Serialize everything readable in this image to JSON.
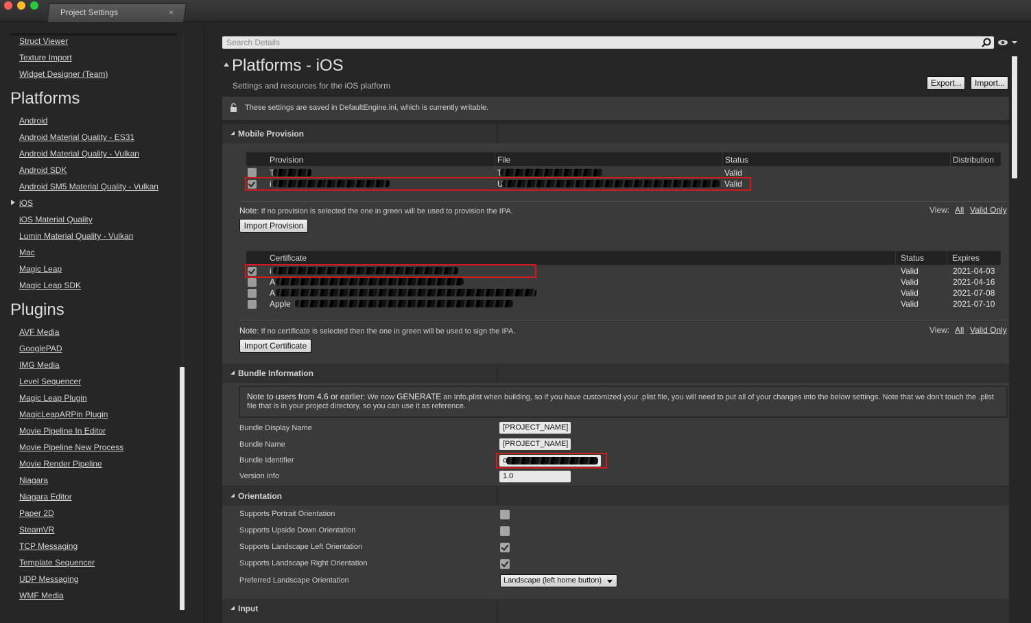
{
  "window": {
    "tab_title": "Project Settings",
    "tab_close": "×"
  },
  "sidebar": {
    "top_items": [
      "Struct Viewer",
      "Texture Import",
      "Widget Designer (Team)"
    ],
    "platforms_heading": "Platforms",
    "platform_items": [
      "Android",
      "Android Material Quality - ES31",
      "Android Material Quality - Vulkan",
      "Android SDK",
      "Android SM5 Material Quality - Vulkan",
      "iOS",
      "iOS Material Quality",
      "Lumin Material Quality - Vulkan",
      "Mac",
      "Magic Leap",
      "Magic Leap SDK"
    ],
    "plugins_heading": "Plugins",
    "plugin_items": [
      "AVF Media",
      "GooglePAD",
      "IMG Media",
      "Level Sequencer",
      "Magic Leap Plugin",
      "MagicLeapARPin Plugin",
      "Movie Pipeline In Editor",
      "Movie Pipeline New Process",
      "Movie Render Pipeline",
      "Niagara",
      "Niagara Editor",
      "Paper 2D",
      "SteamVR",
      "TCP Messaging",
      "Template Sequencer",
      "UDP Messaging",
      "WMF Media"
    ]
  },
  "search": {
    "placeholder": "Search Details"
  },
  "header": {
    "title": "Platforms - iOS",
    "subtitle": "Settings and resources for the iOS platform",
    "export_label": "Export...",
    "import_label": "Import...",
    "info_text": "These settings are saved in DefaultEngine.ini, which is currently writable."
  },
  "mobile_provision": {
    "section_label": "Mobile Provision",
    "provision_table": {
      "columns": [
        "Provision",
        "File",
        "Status",
        "Distribution"
      ],
      "rows": [
        {
          "provision": "T",
          "file": "T",
          "status": "Valid",
          "checked": false
        },
        {
          "provision": "i",
          "file": "U",
          "status": "Valid",
          "checked": true
        }
      ]
    },
    "provision_note_label": "Note",
    "provision_note": ": If no provision is selected the one in green will be used to provision the IPA.",
    "view_label": "View:",
    "view_all": "All",
    "view_valid_only": "Valid Only",
    "import_provision_label": "Import Provision",
    "certificate_table": {
      "columns": [
        "Certificate",
        "Status",
        "Expires"
      ],
      "rows": [
        {
          "certificate": "i",
          "status": "Valid",
          "expires": "2021-04-03",
          "checked": true
        },
        {
          "certificate": "A",
          "status": "Valid",
          "expires": "2021-04-16",
          "checked": false
        },
        {
          "certificate": "A",
          "status": "Valid",
          "expires": "2021-07-08",
          "checked": false
        },
        {
          "certificate": "Apple",
          "status": "Valid",
          "expires": "2021-07-10",
          "checked": false
        }
      ]
    },
    "certificate_note_label": "Note",
    "certificate_note": ": If no certificate is selected then the one in green will be used to sign the IPA.",
    "import_certificate_label": "Import Certificate"
  },
  "bundle_information": {
    "section_label": "Bundle Information",
    "note_label": "Note to users from 4.6 or earlier",
    "note_mid": ": We now ",
    "note_generate": "GENERATE",
    "note_text": " an Info.plist when building, so if you have customized your .plist file, you will need to put all of your changes into the below settings. Note that we don't touch the .plist file that is in your project directory, so you can use it as reference.",
    "display_name_label": "Bundle Display Name",
    "display_name_value": "[PROJECT_NAME]",
    "bundle_name_label": "Bundle Name",
    "bundle_name_value": "[PROJECT_NAME]",
    "identifier_label": "Bundle Identifier",
    "identifier_value": "c",
    "version_label": "Version Info",
    "version_value": "1.0"
  },
  "orientation": {
    "section_label": "Orientation",
    "portrait_label": "Supports Portrait Orientation",
    "portrait_checked": false,
    "upside_down_label": "Supports Upside Down Orientation",
    "upside_down_checked": false,
    "landscape_left_label": "Supports Landscape Left Orientation",
    "landscape_left_checked": true,
    "landscape_right_label": "Supports Landscape Right Orientation",
    "landscape_right_checked": true,
    "preferred_label": "Preferred Landscape Orientation",
    "preferred_value": "Landscape (left home button)"
  },
  "input": {
    "section_label": "Input"
  },
  "colors": {
    "highlight_red": "#d21c1c",
    "panel_bg": "#3a3a3a",
    "section_bg": "#303030"
  }
}
